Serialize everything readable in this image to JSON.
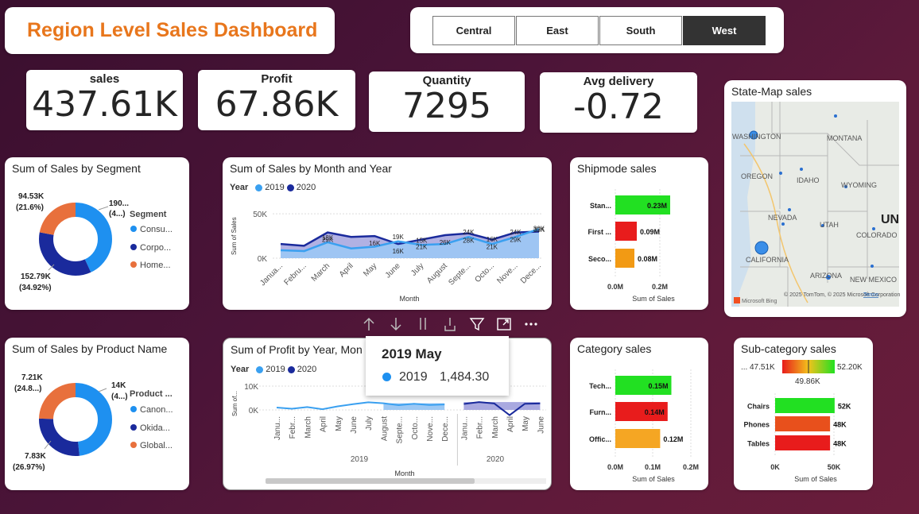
{
  "title": "Region Level Sales Dashboard",
  "region_slicer": {
    "options": [
      "Central",
      "East",
      "South",
      "West"
    ],
    "selected": "West"
  },
  "kpis": {
    "sales": {
      "label": "sales",
      "value": "437.61K"
    },
    "profit": {
      "label": "Profit",
      "value": "67.86K"
    },
    "quantity": {
      "label": "Quantity",
      "value": "7295"
    },
    "delivery": {
      "label": "Avg delivery",
      "value": "-0.72"
    }
  },
  "segment_donut": {
    "title": "Sum of Sales by Segment",
    "legend_title": "Segment",
    "legend": [
      "Consu...",
      "Corpo...",
      "Home..."
    ],
    "labels": {
      "top_right": [
        "190...",
        "(4...)"
      ],
      "top_left": [
        "94.53K",
        "(21.6%)"
      ],
      "bottom_left": [
        "152.79K",
        "(34.92%)"
      ]
    },
    "colors": [
      "#1e90f0",
      "#1a2a9c",
      "#e8703c"
    ]
  },
  "product_donut": {
    "title": "Sum of Sales by Product Name",
    "legend_title": "Product ...",
    "legend": [
      "Canon...",
      "Okida...",
      "Global..."
    ],
    "labels": {
      "top_right": [
        "14K",
        "(4...)"
      ],
      "top_left": [
        "7.21K",
        "(24.8...)"
      ],
      "bottom_left": [
        "7.83K",
        "(26.97%)"
      ]
    },
    "colors": [
      "#1e90f0",
      "#1a2a9c",
      "#e8703c"
    ]
  },
  "chart_data": [
    {
      "type": "area",
      "title": "Sum of Sales by Month and Year",
      "legend_title": "Year",
      "xlabel": "Month",
      "ylabel": "Sum of Sales",
      "yticks": [
        "50K",
        "0K"
      ],
      "ylim": [
        0,
        60000
      ],
      "categories": [
        "Janua...",
        "Febru...",
        "March",
        "April",
        "May",
        "June",
        "July",
        "August",
        "Septe...",
        "Octo...",
        "Nove...",
        "Dece..."
      ],
      "series": [
        {
          "name": "2019",
          "color": "#3aa0f0",
          "values": [
            9000,
            8000,
            18000,
            11000,
            13000,
            19000,
            15000,
            16000,
            24000,
            16000,
            24000,
            33000
          ],
          "labels": [
            "",
            "",
            "18K",
            "",
            "",
            "19K",
            "15K",
            "",
            "24K",
            "16K",
            "24K",
            "33K"
          ]
        },
        {
          "name": "2020",
          "color": "#1a2a9c",
          "values": [
            16000,
            14000,
            29000,
            24000,
            25000,
            16000,
            21000,
            26000,
            28000,
            21000,
            29000,
            30000
          ],
          "labels": [
            "",
            "",
            "29K",
            "",
            "16K",
            "16K",
            "21K",
            "26K",
            "28K",
            "21K",
            "29K",
            "30K"
          ]
        }
      ]
    },
    {
      "type": "line",
      "title": "Sum of Profit by Year, Mon",
      "legend_title": "Year",
      "xlabel": "Month",
      "ylabel": "Sum of...",
      "yticks": [
        "10K",
        "0K"
      ],
      "years": [
        "2019",
        "2020"
      ],
      "categories_2019": [
        "Janu...",
        "Febr...",
        "March",
        "April",
        "May",
        "June",
        "July",
        "August",
        "Septe...",
        "Octo...",
        "Nove...",
        "Dece..."
      ],
      "categories_2020": [
        "Janu...",
        "Febr...",
        "March",
        "April",
        "May",
        "June"
      ],
      "series": [
        {
          "name": "2019",
          "color": "#3aa0f0",
          "values": [
            1000,
            500,
            1200,
            300,
            1484,
            2400,
            3200,
            2800,
            2000,
            2600,
            2100,
            2300
          ]
        },
        {
          "name": "2020",
          "color": "#1a2a9c",
          "values": [
            2500,
            3300,
            2700,
            -2200,
            2600,
            2700
          ]
        }
      ]
    },
    {
      "type": "bar",
      "title": "Shipmode sales",
      "xlabel": "Sum of Sales",
      "xticks": [
        "0.0M",
        "0.2M"
      ],
      "categories": [
        "Stan...",
        "First ...",
        "Seco..."
      ],
      "values": [
        0.23,
        0.09,
        0.08
      ],
      "labels": [
        "0.23M",
        "0.09M",
        "0.08M"
      ],
      "colors": [
        "#22e022",
        "#e81c1c",
        "#f29a14"
      ]
    },
    {
      "type": "bar",
      "title": "Category sales",
      "xlabel": "Sum of Sales",
      "xticks": [
        "0.0M",
        "0.1M",
        "0.2M"
      ],
      "categories": [
        "Tech...",
        "Furn...",
        "Offic..."
      ],
      "values": [
        0.15,
        0.14,
        0.12
      ],
      "labels": [
        "0.15M",
        "0.14M",
        "0.12M"
      ],
      "colors": [
        "#22e022",
        "#e81c1c",
        "#f5a623"
      ]
    },
    {
      "type": "bar",
      "title": "Sub-category sales",
      "xlabel": "Sum of Sales",
      "xticks": [
        "0K",
        "50K"
      ],
      "categories": [
        "Chairs",
        "Phones",
        "Tables"
      ],
      "values": [
        52000,
        48000,
        48000
      ],
      "labels": [
        "52K",
        "48K",
        "48K"
      ],
      "colors": [
        "#22e022",
        "#e8501c",
        "#e81c1c"
      ],
      "gradient_legend": {
        "prefix": "...",
        "min": "47.51K",
        "mid": "49.86K",
        "max": "52.20K"
      }
    }
  ],
  "map": {
    "title": "State-Map sales",
    "labels": [
      "WASHINGTON",
      "MONTANA",
      "OREGON",
      "IDAHO",
      "WYOMING",
      "NEVADA",
      "UTAH",
      "COLORADO",
      "CALIFORNIA",
      "ARIZONA",
      "NEW MEXICO",
      "UN"
    ],
    "attribution": "© 2025 TomTom, © 2025 Microsoft Corporation",
    "terms": "Terms",
    "brand": "Microsoft Bing"
  },
  "tooltip": {
    "title": "2019 May",
    "year": "2019",
    "value": "1,484.30"
  }
}
